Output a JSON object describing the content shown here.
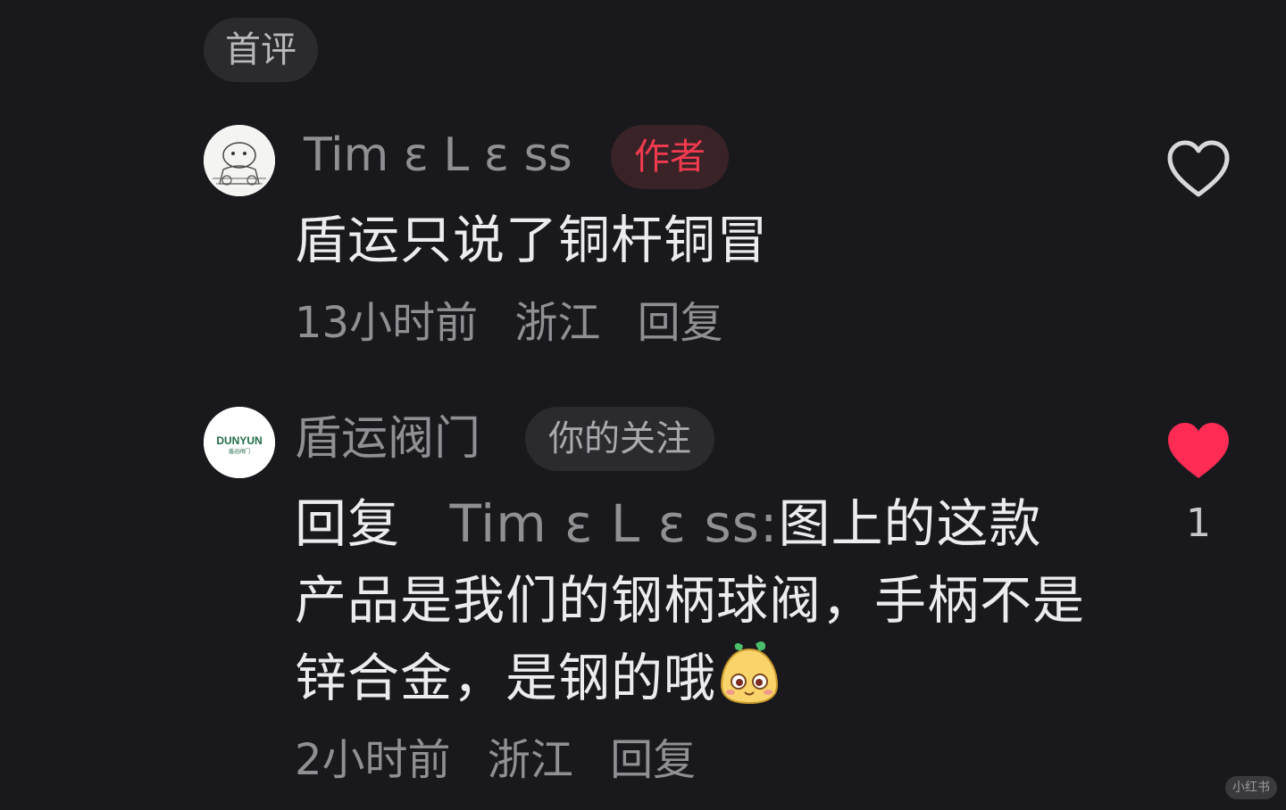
{
  "section_label": "首评",
  "comments": [
    {
      "username": "Tim ε  L ε ss",
      "badge": "作者",
      "content": "盾运只说了铜杆铜冒",
      "time": "13小时前",
      "location": "浙江",
      "reply_label": "回复",
      "liked": false,
      "like_count": ""
    },
    {
      "username": "盾运阀门",
      "avatar_text": "DUNYUN",
      "avatar_subtext": "盾运阀门",
      "badge": "你的关注",
      "reply_prefix": "回复",
      "reply_target": "Tim ε  L ε ss:",
      "content": "图上的这款产品是我们的钢柄球阀，手柄不是锌合金，是钢的哦",
      "emoji": "smiling-face-sticker",
      "time": "2小时前",
      "location": "浙江",
      "reply_label": "回复",
      "liked": true,
      "like_count": "1"
    }
  ],
  "watermark": "小红书",
  "colors": {
    "background": "#19181c",
    "like_active": "#fe2c55",
    "author_badge_text": "#f23a4f"
  }
}
